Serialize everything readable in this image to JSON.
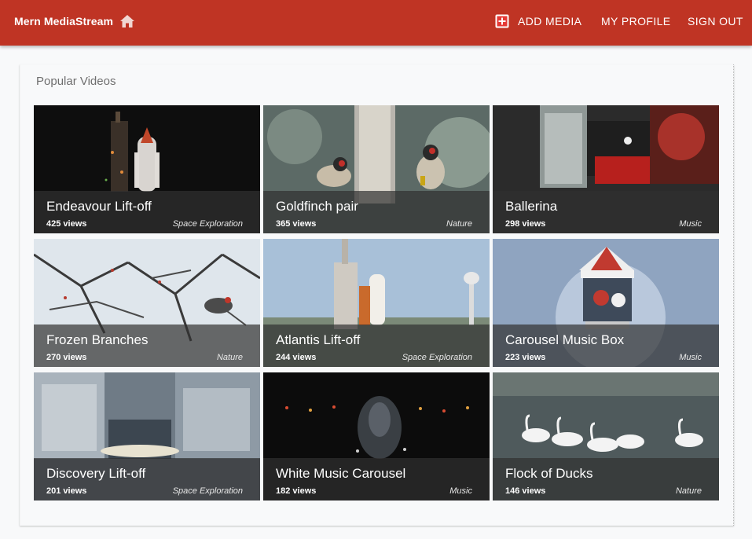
{
  "app": {
    "title": "Mern MediaStream",
    "home_icon": "home-icon",
    "brand_color": "#bf3424"
  },
  "nav": {
    "add_media": "ADD MEDIA",
    "add_media_icon": "add-box-icon",
    "my_profile": "MY PROFILE",
    "sign_out": "SIGN OUT"
  },
  "section": {
    "title": "Popular Videos"
  },
  "videos": [
    {
      "title": "Endeavour Lift-off",
      "views": "425 views",
      "genre": "Space Exploration"
    },
    {
      "title": "Goldfinch pair",
      "views": "365 views",
      "genre": "Nature"
    },
    {
      "title": "Ballerina",
      "views": "298 views",
      "genre": "Music"
    },
    {
      "title": "Frozen Branches",
      "views": "270 views",
      "genre": "Nature"
    },
    {
      "title": "Atlantis Lift-off",
      "views": "244 views",
      "genre": "Space Exploration"
    },
    {
      "title": "Carousel Music Box",
      "views": "223 views",
      "genre": "Music"
    },
    {
      "title": "Discovery Lift-off",
      "views": "201 views",
      "genre": "Space Exploration"
    },
    {
      "title": "White Music Carousel",
      "views": "182 views",
      "genre": "Music"
    },
    {
      "title": "Flock of Ducks",
      "views": "146 views",
      "genre": "Nature"
    }
  ]
}
